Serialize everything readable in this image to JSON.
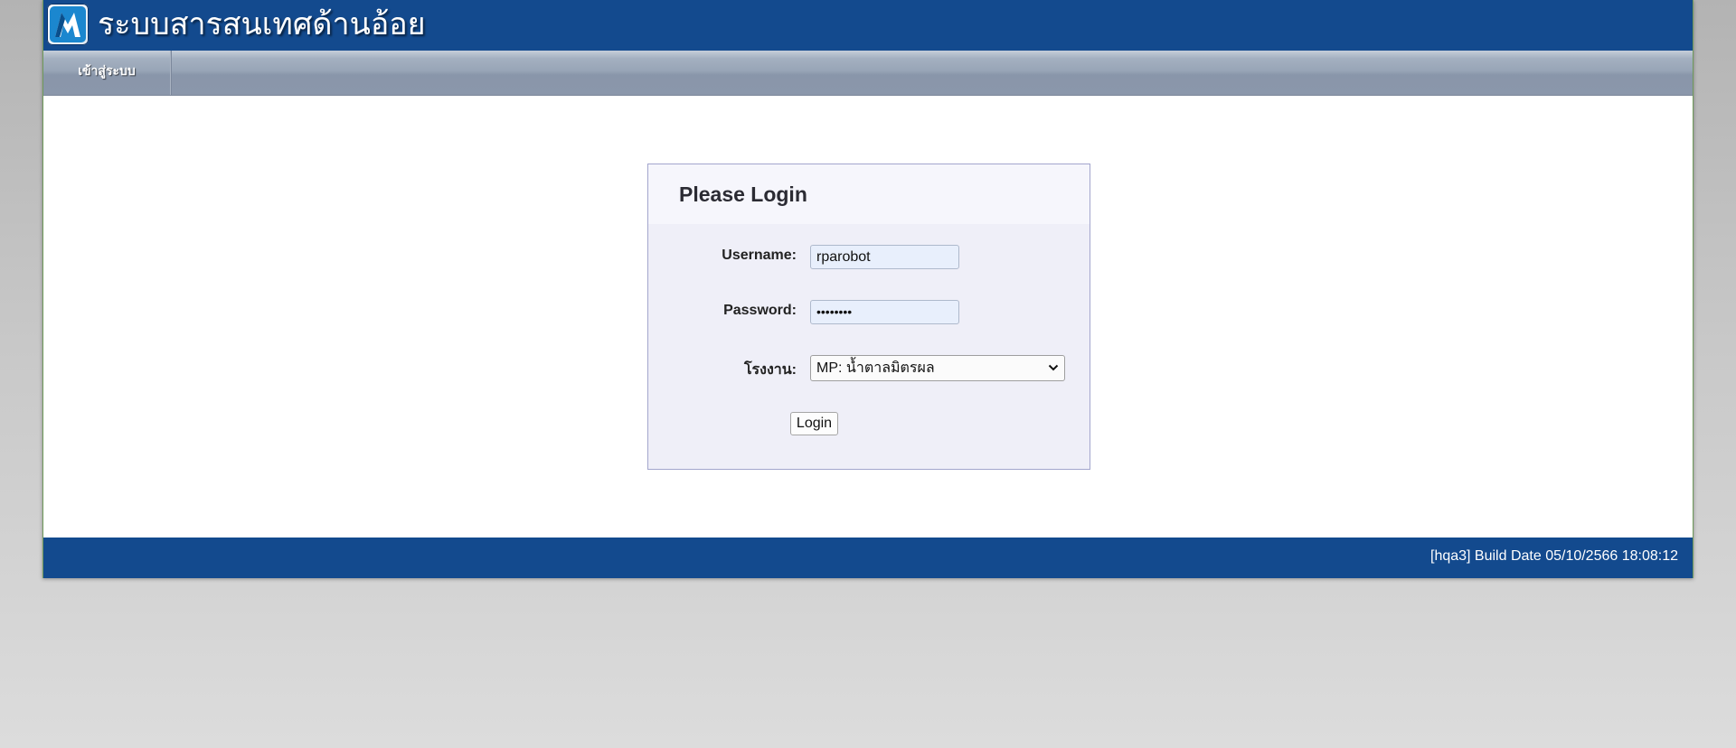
{
  "header": {
    "site_title": "ระบบสารสนเทศด้านอ้อย",
    "logo_icon": "company-logo",
    "banner_color": "#134a8e"
  },
  "nav": {
    "items": [
      {
        "label": "เข้าสู่ระบบ"
      }
    ]
  },
  "login": {
    "title": "Please Login",
    "username_label": "Username:",
    "username_value": "rparobot",
    "password_label": "Password:",
    "password_value": "••••••••",
    "factory_label": "โรงงาน:",
    "factory_selected": "MP: น้ำตาลมิตรผล",
    "submit_label": "Login"
  },
  "footer": {
    "build_info": "[hqa3] Build Date 05/10/2566 18:08:12"
  }
}
